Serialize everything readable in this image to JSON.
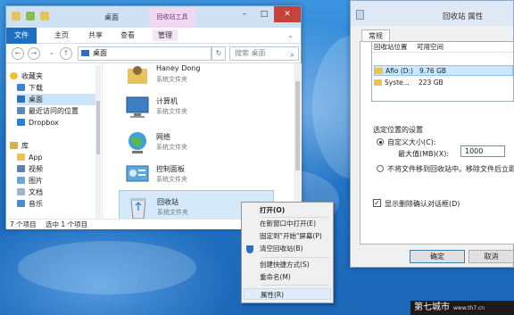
{
  "explorer": {
    "title": "桌面",
    "tool_tab": "回收站工具",
    "ribbon_tabs": [
      "文件",
      "主页",
      "共享",
      "查看",
      "管理"
    ],
    "address": "桌面",
    "search_placeholder": "搜索 桌面",
    "nav_items": [
      {
        "label": "收藏夹",
        "icon": "star-icon"
      },
      {
        "label": "下载",
        "icon": "download-icon"
      },
      {
        "label": "桌面",
        "icon": "desktop-icon"
      },
      {
        "label": "最近访问的位置",
        "icon": "recent-icon"
      },
      {
        "label": "Dropbox",
        "icon": "dropbox-icon"
      },
      {
        "label": "库",
        "icon": "library-icon"
      },
      {
        "label": "App",
        "icon": "folder-icon"
      },
      {
        "label": "视频",
        "icon": "video-icon"
      },
      {
        "label": "图片",
        "icon": "picture-icon"
      },
      {
        "label": "文档",
        "icon": "document-icon"
      },
      {
        "label": "音乐",
        "icon": "music-icon"
      }
    ],
    "items": [
      {
        "name": "Haney Dong",
        "type": "系统文件夹",
        "icon": "user-folder-icon"
      },
      {
        "name": "计算机",
        "type": "系统文件夹",
        "icon": "computer-icon"
      },
      {
        "name": "网络",
        "type": "系统文件夹",
        "icon": "network-icon"
      },
      {
        "name": "控制面板",
        "type": "系统文件夹",
        "icon": "control-panel-icon"
      },
      {
        "name": "回收站",
        "type": "系统文件夹",
        "icon": "recycle-bin-icon"
      }
    ],
    "status_left": "7 个项目",
    "status_selected": "选中 1 个项目"
  },
  "context_menu": {
    "items": [
      "打开(O)",
      "在新窗口中打开(E)",
      "固定到\"开始\"屏幕(P)",
      "清空回收站(B)",
      "创建快捷方式(S)",
      "重命名(M)",
      "属性(R)"
    ]
  },
  "properties": {
    "title": "回收站 属性",
    "tab": "常规",
    "columns": [
      "回收站位置",
      "可用空间"
    ],
    "locations": [
      {
        "name": "Afio (D:)",
        "space": "9.76 GB"
      },
      {
        "name": "Syste...",
        "space": "223 GB"
      }
    ],
    "group_label": "选定位置的设置",
    "custom_size_label": "自定义大小(C):",
    "max_size_label": "最大值(MB)(X):",
    "max_size_value": "1000",
    "no_move_label": "不将文件移到回收站中。移除文件后立即",
    "confirm_label": "显示删除确认对话框(D)",
    "ok_label": "确定",
    "cancel_label": "取消"
  },
  "watermark": {
    "text": "第七城市",
    "url": "www.th7.cn"
  }
}
